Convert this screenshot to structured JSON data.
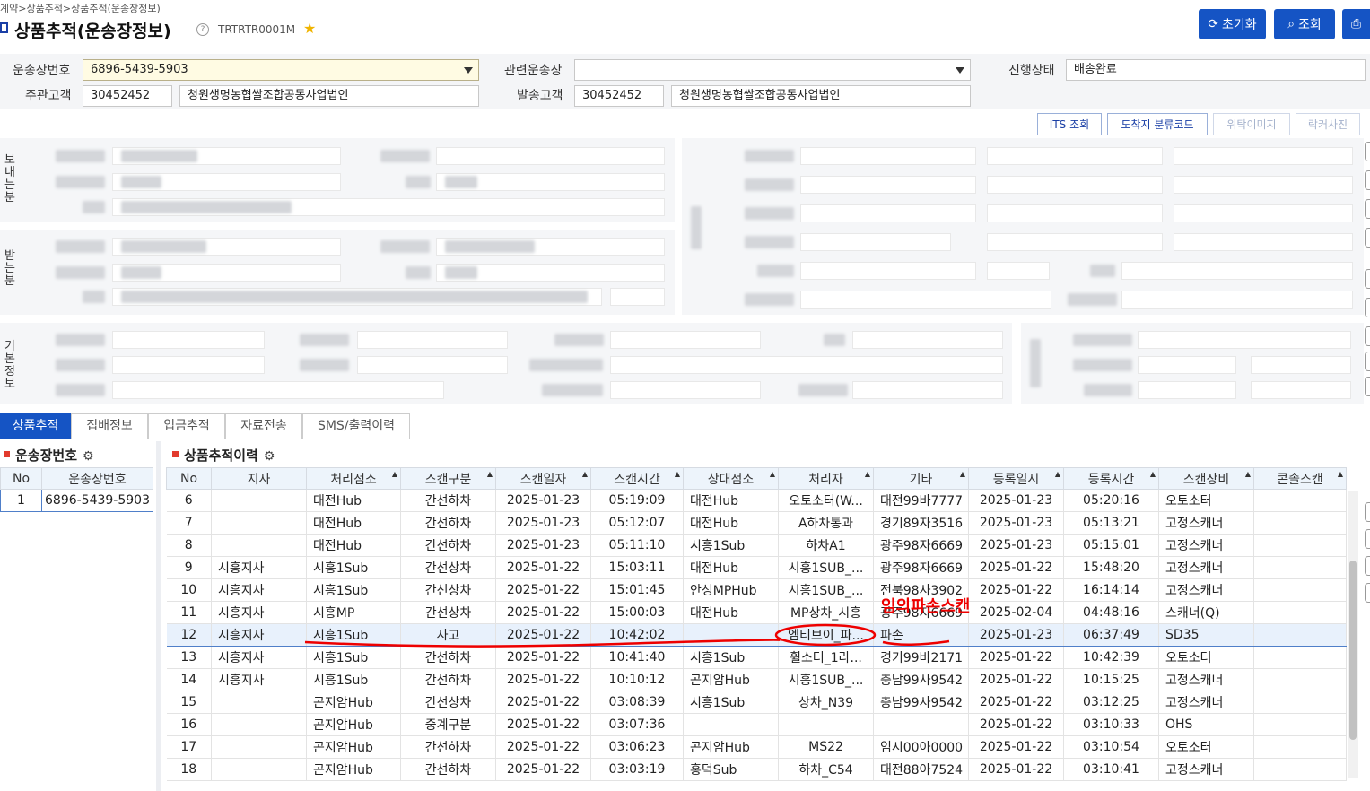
{
  "breadcrumb": "계약>상품추적>상품추적(운송장정보)",
  "page": {
    "title": "상품추적(운송장정보)",
    "code": "TRTRTR0001M"
  },
  "toolbar": {
    "reset": "초기화",
    "search": "조회"
  },
  "form": {
    "waybill_label": "운송장번호",
    "waybill_value": "6896-5439-5903",
    "related_label": "관련운송장",
    "related_value": "",
    "status_label": "진행상태",
    "status_value": "배송완료",
    "customer_label": "주관고객",
    "customer_code": "30452452",
    "customer_name": "청원생명농협쌀조합공동사업법인",
    "shipper_label": "발송고객",
    "shipper_code": "30452452",
    "shipper_name": "청원생명농협쌀조합공동사업법인"
  },
  "actions": {
    "its": "ITS 조회",
    "dest_code": "도착지 분류코드",
    "consign_image": "위탁이미지",
    "drop_photo": "락커사진"
  },
  "sections": {
    "sender": "보내는분",
    "receiver": "받는분",
    "basic": "기본정보"
  },
  "tabs": [
    "상품추적",
    "집배정보",
    "입금추적",
    "자료전송",
    "SMS/출력이력"
  ],
  "left_grid": {
    "title": "운송장번호",
    "headers": [
      "No",
      "운송장번호"
    ],
    "rows": [
      [
        "1",
        "6896-5439-5903"
      ]
    ]
  },
  "history": {
    "title": "상품추적이력",
    "headers": [
      "No",
      "지사",
      "처리점소",
      "스캔구분",
      "스캔일자",
      "스캔시간",
      "상대점소",
      "처리자",
      "기타",
      "등록일시",
      "등록시간",
      "스캔장비",
      "콘솔스캔"
    ],
    "rows": [
      [
        "6",
        "",
        "대전Hub",
        "간선하차",
        "2025-01-23",
        "05:19:09",
        "대전Hub",
        "오토소터(W...",
        "대전99바7777",
        "2025-01-23",
        "05:20:16",
        "오토소터",
        ""
      ],
      [
        "7",
        "",
        "대전Hub",
        "간선하차",
        "2025-01-23",
        "05:12:07",
        "대전Hub",
        "A하차통과",
        "경기89자3516",
        "2025-01-23",
        "05:13:21",
        "고정스캐너",
        ""
      ],
      [
        "8",
        "",
        "대전Hub",
        "간선하차",
        "2025-01-23",
        "05:11:10",
        "시흥1Sub",
        "하차A1",
        "광주98자6669",
        "2025-01-23",
        "05:15:01",
        "고정스캐너",
        ""
      ],
      [
        "9",
        "시흥지사",
        "시흥1Sub",
        "간선상차",
        "2025-01-22",
        "15:03:11",
        "대전Hub",
        "시흥1SUB_...",
        "광주98자6669",
        "2025-01-22",
        "15:48:20",
        "고정스캐너",
        ""
      ],
      [
        "10",
        "시흥지사",
        "시흥1Sub",
        "간선상차",
        "2025-01-22",
        "15:01:45",
        "안성MPHub",
        "시흥1SUB_...",
        "전북98사3902",
        "2025-01-22",
        "16:14:14",
        "고정스캐너",
        ""
      ],
      [
        "11",
        "시흥지사",
        "시흥MP",
        "간선상차",
        "2025-01-22",
        "15:00:03",
        "대전Hub",
        "MP상차_시흥",
        "광주98자6669",
        "2025-02-04",
        "04:48:16",
        "스캐너(Q)",
        ""
      ],
      [
        "12",
        "시흥지사",
        "시흥1Sub",
        "사고",
        "2025-01-22",
        "10:42:02",
        "",
        "엠티브이_파...",
        "파손",
        "2025-01-23",
        "06:37:49",
        "SD35",
        ""
      ],
      [
        "13",
        "시흥지사",
        "시흥1Sub",
        "간선하차",
        "2025-01-22",
        "10:41:40",
        "시흥1Sub",
        "휠소터_1라...",
        "경기99바2171",
        "2025-01-22",
        "10:42:39",
        "오토소터",
        ""
      ],
      [
        "14",
        "시흥지사",
        "시흥1Sub",
        "간선하차",
        "2025-01-22",
        "10:10:12",
        "곤지암Hub",
        "시흥1SUB_...",
        "충남99사9542",
        "2025-01-22",
        "10:15:25",
        "고정스캐너",
        ""
      ],
      [
        "15",
        "",
        "곤지암Hub",
        "간선상차",
        "2025-01-22",
        "03:08:39",
        "시흥1Sub",
        "상차_N39",
        "충남99사9542",
        "2025-01-22",
        "03:12:25",
        "고정스캐너",
        ""
      ],
      [
        "16",
        "",
        "곤지암Hub",
        "중계구분",
        "2025-01-22",
        "03:07:36",
        "",
        "",
        "",
        "2025-01-22",
        "03:10:33",
        "OHS",
        ""
      ],
      [
        "17",
        "",
        "곤지암Hub",
        "간선하차",
        "2025-01-22",
        "03:06:23",
        "곤지암Hub",
        "MS22",
        "임시00아0000",
        "2025-01-22",
        "03:10:54",
        "오토소터",
        ""
      ],
      [
        "18",
        "",
        "곤지암Hub",
        "간선하차",
        "2025-01-22",
        "03:03:19",
        "홍덕Sub",
        "하차_C54",
        "대전88아7524",
        "2025-01-22",
        "03:10:41",
        "고정스캐너",
        ""
      ]
    ],
    "selected_index": 6
  },
  "annotation": {
    "text": "임의파손스캔",
    "color": "#e00000"
  },
  "colors": {
    "primary": "#1554c4",
    "accent": "#e23b2e"
  },
  "icons": {
    "reset": "refresh-icon",
    "search": "search-icon",
    "print": "print-icon",
    "settings": "gear-icon",
    "favorite": "star-icon",
    "help": "help-icon"
  }
}
